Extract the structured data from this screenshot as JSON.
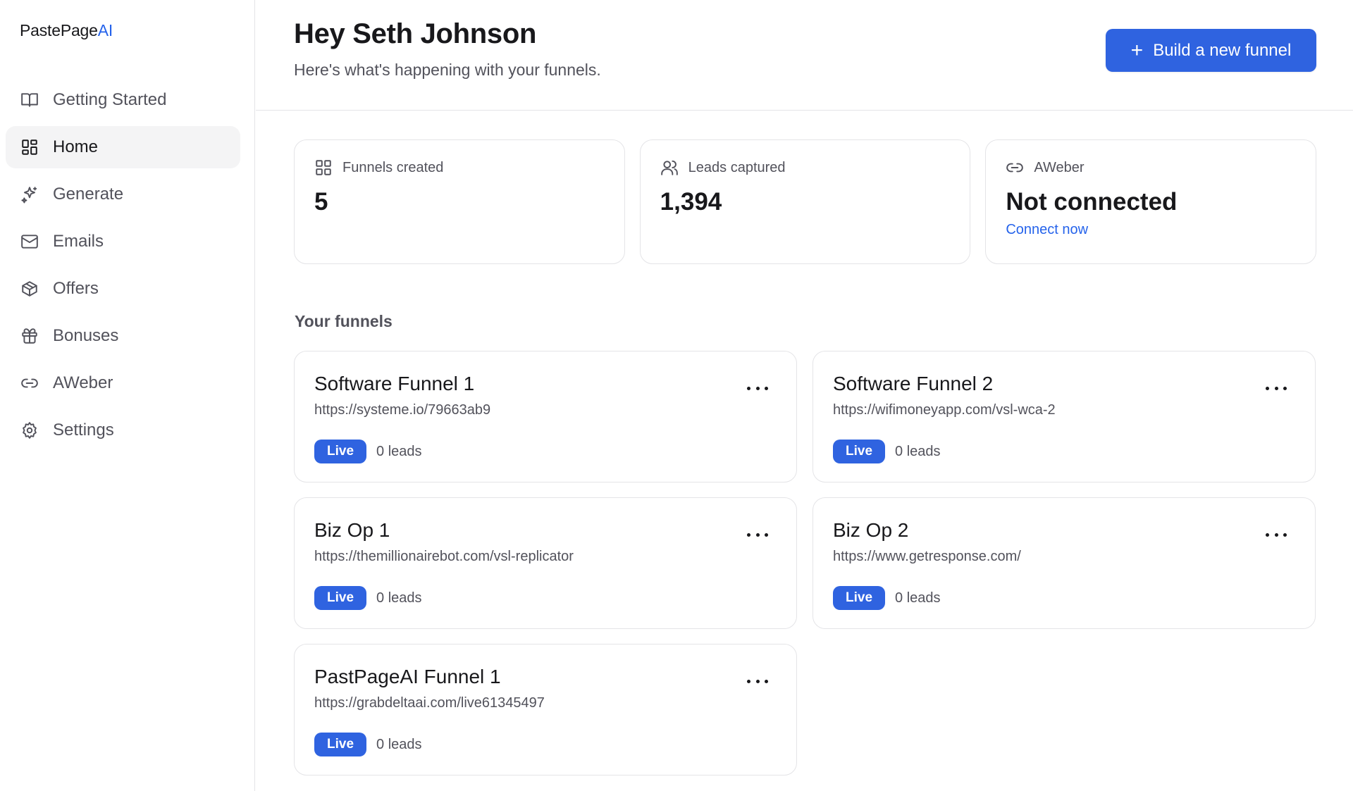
{
  "app": {
    "logo_text": "PastePage",
    "logo_accent": "AI",
    "accent_color": "#2f63e0"
  },
  "sidebar": {
    "items": [
      {
        "label": "Getting Started",
        "icon": "book-icon",
        "active": false
      },
      {
        "label": "Home",
        "icon": "grid-icon",
        "active": true
      },
      {
        "label": "Generate",
        "icon": "sparkle-icon",
        "active": false
      },
      {
        "label": "Emails",
        "icon": "mail-icon",
        "active": false
      },
      {
        "label": "Offers",
        "icon": "package-icon",
        "active": false
      },
      {
        "label": "Bonuses",
        "icon": "gift-icon",
        "active": false
      },
      {
        "label": "AWeber",
        "icon": "link-icon",
        "active": false
      },
      {
        "label": "Settings",
        "icon": "gear-icon",
        "active": false
      }
    ]
  },
  "header": {
    "greeting": "Hey Seth Johnson",
    "subtitle": "Here's what's happening with your funnels.",
    "build_button": "Build a new funnel"
  },
  "stats": {
    "funnels": {
      "label": "Funnels created",
      "value": "5",
      "icon": "grid-icon"
    },
    "leads": {
      "label": "Leads captured",
      "value": "1,394",
      "icon": "users-icon"
    },
    "aweber": {
      "label": "AWeber",
      "value": "Not connected",
      "link": "Connect now",
      "icon": "link-icon"
    }
  },
  "funnels_section": {
    "title": "Your funnels",
    "items": [
      {
        "name": "Software Funnel 1",
        "url": "https://systeme.io/79663ab9",
        "status": "Live",
        "leads": "0 leads"
      },
      {
        "name": "Software Funnel 2",
        "url": "https://wifimoneyapp.com/vsl-wca-2",
        "status": "Live",
        "leads": "0 leads"
      },
      {
        "name": "Biz Op 1",
        "url": "https://themillionairebot.com/vsl-replicator",
        "status": "Live",
        "leads": "0 leads"
      },
      {
        "name": "Biz Op 2",
        "url": "https://www.getresponse.com/",
        "status": "Live",
        "leads": "0 leads"
      },
      {
        "name": "PastPageAI Funnel 1",
        "url": "https://grabdeltaai.com/live61345497",
        "status": "Live",
        "leads": "0 leads"
      }
    ]
  }
}
